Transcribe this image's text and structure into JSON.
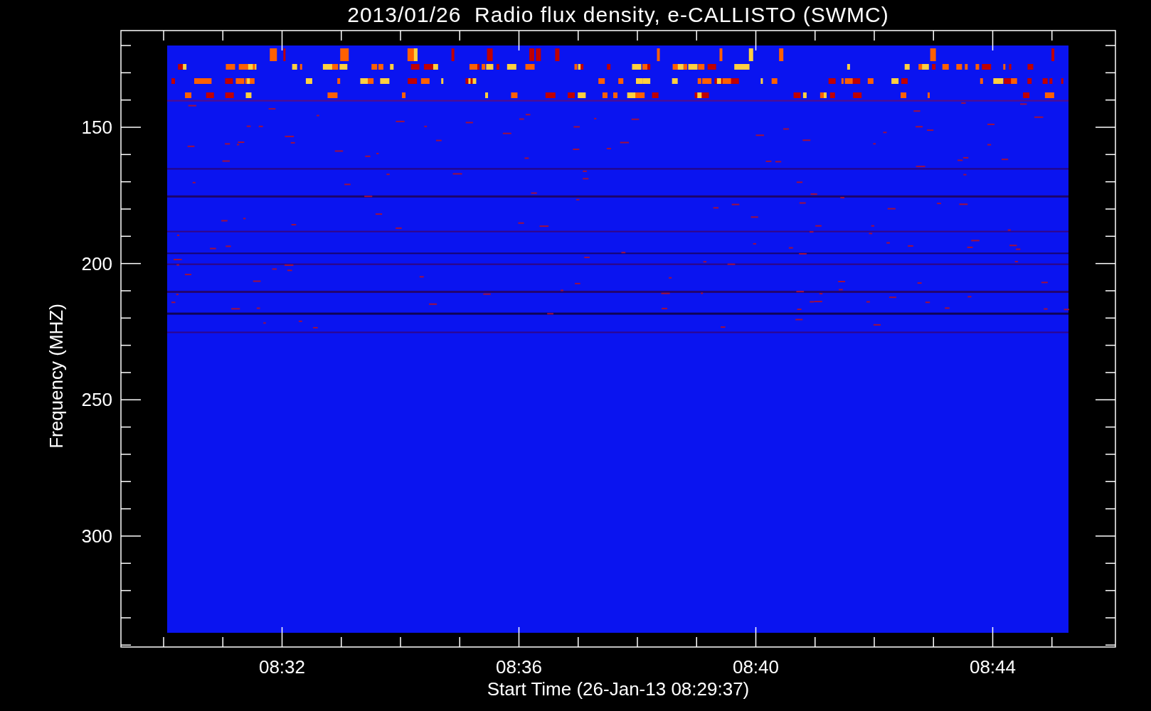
{
  "title": "2013/01/26  Radio flux density, e-CALLISTO (SWMC)",
  "plot": {
    "y_axis": {
      "label": "Frequency (MHZ)",
      "ticks": [
        "150",
        "200",
        "250",
        "300"
      ]
    },
    "x_axis": {
      "label": "Start Time (26-Jan-13 08:29:37)",
      "ticks": [
        "08:32",
        "08:36",
        "08:40",
        "08:44"
      ]
    }
  }
}
